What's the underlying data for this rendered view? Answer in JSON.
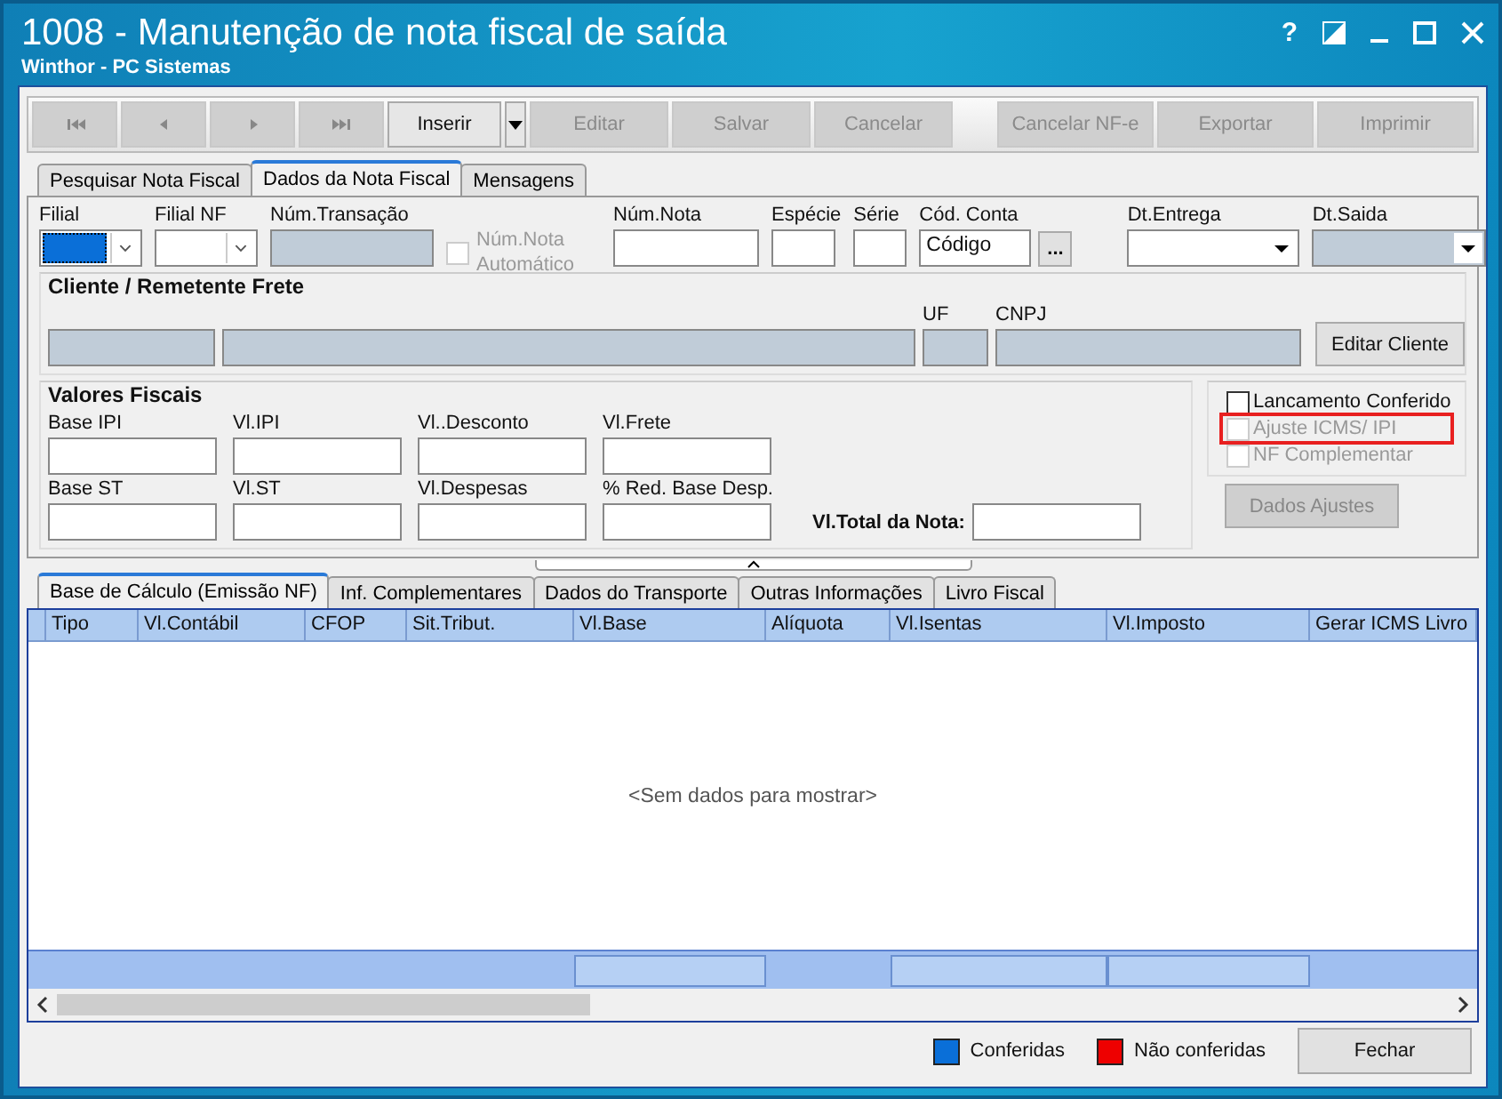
{
  "window": {
    "title": "1008 - Manutenção de nota fiscal de saída",
    "subtitle": "Winthor - PC Sistemas",
    "help": "?"
  },
  "toolbar": {
    "left": [
      {
        "kind": "first",
        "disabled": true
      },
      {
        "kind": "prev",
        "disabled": true
      },
      {
        "kind": "next",
        "disabled": true
      },
      {
        "kind": "last",
        "disabled": true
      },
      {
        "kind": "text",
        "label": "Inserir",
        "disabled": false,
        "dropdown": true
      },
      {
        "kind": "text",
        "label": "Editar",
        "disabled": true
      },
      {
        "kind": "text",
        "label": "Salvar",
        "disabled": true
      },
      {
        "kind": "text",
        "label": "Cancelar",
        "disabled": true
      }
    ],
    "right": [
      {
        "kind": "text",
        "label": "Cancelar NF-e",
        "disabled": true
      },
      {
        "kind": "text",
        "label": "Exportar",
        "disabled": true
      },
      {
        "kind": "text",
        "label": "Imprimir",
        "disabled": true
      }
    ]
  },
  "tabs": [
    {
      "label": "Pesquisar Nota Fiscal",
      "selected": false
    },
    {
      "label": "Dados da Nota Fiscal",
      "selected": true
    },
    {
      "label": "Mensagens",
      "selected": false
    }
  ],
  "header_fields": [
    {
      "kind": "combo",
      "label": "Filial",
      "focused": true
    },
    {
      "kind": "combo",
      "label": "Filial NF",
      "focused": false
    },
    {
      "kind": "readonly",
      "label": "Núm.Transação"
    },
    {
      "kind": "checkbox",
      "label": "Núm.Nota Automático",
      "checked": false,
      "disabled": true
    },
    {
      "kind": "text",
      "label": "Núm.Nota"
    },
    {
      "kind": "text",
      "label": "Espécie"
    },
    {
      "kind": "text",
      "label": "Série"
    },
    {
      "kind": "lookup",
      "label": "Cód. Conta",
      "value": "Código",
      "button": "..."
    },
    {
      "kind": "date",
      "label": "Dt.Entrega",
      "disabled": false
    },
    {
      "kind": "date",
      "label": "Dt.Saida",
      "disabled": true
    }
  ],
  "cliente": {
    "title": "Cliente / Remetente Frete",
    "fields": [
      {
        "kind": "readonly"
      },
      {
        "kind": "readonly"
      },
      {
        "kind": "readonly",
        "label": "UF"
      },
      {
        "kind": "readonly",
        "label": "CNPJ"
      }
    ],
    "button": "Editar Cliente"
  },
  "valores": {
    "title": "Valores Fiscais",
    "fields": [
      "Base IPI",
      "Vl.IPI",
      "Vl..Desconto",
      "Vl.Frete",
      "Base ST",
      "Vl.ST",
      "Vl.Despesas",
      "% Red. Base Desp."
    ],
    "total_label": "Vl.Total da Nota:"
  },
  "flags": [
    {
      "label": "Lancamento Conferido",
      "checked": false,
      "disabled": false,
      "highlighted": false
    },
    {
      "label": "Ajuste ICMS/ IPI",
      "checked": false,
      "disabled": true,
      "highlighted": true
    },
    {
      "label": "NF Complementar",
      "checked": false,
      "disabled": true,
      "highlighted": false
    }
  ],
  "adjust_button": {
    "label": "Dados Ajustes",
    "disabled": true
  },
  "lower_tabs": [
    {
      "label": "Base de Cálculo (Emissão NF)",
      "selected": true
    },
    {
      "label": "Inf. Complementares",
      "selected": false
    },
    {
      "label": "Dados do Transporte",
      "selected": false
    },
    {
      "label": "Outras Informações",
      "selected": false
    },
    {
      "label": "Livro Fiscal",
      "selected": false
    }
  ],
  "table": {
    "columns": [
      "Tipo",
      "Vl.Contábil",
      "CFOP",
      "Sit.Tribut.",
      "Vl.Base",
      "Alíquota",
      "Vl.Isentas",
      "Vl.Imposto",
      "Gerar ICMS Livro"
    ],
    "empty": "<Sem dados para mostrar>"
  },
  "legend": [
    {
      "label": "Conferidas",
      "color": "#0a6fd8"
    },
    {
      "label": "Não conferidas",
      "color": "#ee0000"
    }
  ],
  "close_button": "Fechar"
}
